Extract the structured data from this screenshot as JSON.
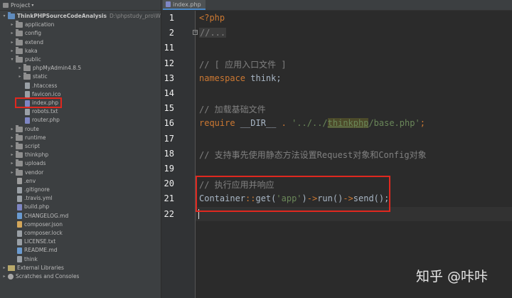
{
  "project_panel": {
    "title": "Project",
    "tree": [
      {
        "label": "ThinkPHPSourceCodeAnalysis",
        "extra": "D:\\phpstudy_pro\\WWW\\Th",
        "type": "root",
        "depth": 0,
        "expanded": true
      },
      {
        "label": "application",
        "type": "folder",
        "depth": 1,
        "expanded": false
      },
      {
        "label": "config",
        "type": "folder",
        "depth": 1,
        "expanded": false
      },
      {
        "label": "extend",
        "type": "folder",
        "depth": 1,
        "expanded": false
      },
      {
        "label": "kaka",
        "type": "folder",
        "depth": 1,
        "expanded": false
      },
      {
        "label": "public",
        "type": "folder",
        "depth": 1,
        "expanded": true
      },
      {
        "label": "phpMyAdmin4.8.5",
        "type": "folder",
        "depth": 2,
        "expanded": false
      },
      {
        "label": "static",
        "type": "folder",
        "depth": 2,
        "expanded": false
      },
      {
        "label": ".htaccess",
        "type": "file-txt",
        "depth": 2
      },
      {
        "label": "favicon.ico",
        "type": "file-txt",
        "depth": 2
      },
      {
        "label": "index.php",
        "type": "file-php",
        "depth": 2,
        "selected": true
      },
      {
        "label": "robots.txt",
        "type": "file-txt",
        "depth": 2
      },
      {
        "label": "router.php",
        "type": "file-php",
        "depth": 2
      },
      {
        "label": "route",
        "type": "folder",
        "depth": 1,
        "expanded": false
      },
      {
        "label": "runtime",
        "type": "folder",
        "depth": 1,
        "expanded": false
      },
      {
        "label": "script",
        "type": "folder",
        "depth": 1,
        "expanded": false
      },
      {
        "label": "thinkphp",
        "type": "folder",
        "depth": 1,
        "expanded": false
      },
      {
        "label": "uploads",
        "type": "folder",
        "depth": 1,
        "expanded": false
      },
      {
        "label": "vendor",
        "type": "folder",
        "depth": 1,
        "expanded": false
      },
      {
        "label": ".env",
        "type": "file-env",
        "depth": 1
      },
      {
        "label": ".gitignore",
        "type": "file-txt",
        "depth": 1
      },
      {
        "label": ".travis.yml",
        "type": "file-txt",
        "depth": 1
      },
      {
        "label": "build.php",
        "type": "file-php",
        "depth": 1
      },
      {
        "label": "CHANGELOG.md",
        "type": "file-md",
        "depth": 1
      },
      {
        "label": "composer.json",
        "type": "file-json",
        "depth": 1
      },
      {
        "label": "composer.lock",
        "type": "file-txt",
        "depth": 1
      },
      {
        "label": "LICENSE.txt",
        "type": "file-txt",
        "depth": 1
      },
      {
        "label": "README.md",
        "type": "file-md",
        "depth": 1
      },
      {
        "label": "think",
        "type": "file-txt",
        "depth": 1
      },
      {
        "label": "External Libraries",
        "type": "lib",
        "depth": 0,
        "expanded": false
      },
      {
        "label": "Scratches and Consoles",
        "type": "scratch",
        "depth": 0,
        "expanded": false
      }
    ]
  },
  "editor": {
    "tab_label": "index.php",
    "lines": [
      {
        "num": "1",
        "tokens": [
          {
            "t": "<?php",
            "c": "tag"
          }
        ]
      },
      {
        "num": "2",
        "fold": "+",
        "tokens": [
          {
            "t": "//...",
            "c": "fold-cm"
          }
        ]
      },
      {
        "num": "11",
        "tokens": []
      },
      {
        "num": "12",
        "tokens": [
          {
            "t": "// [ 应用入口文件 ]",
            "c": "cm"
          }
        ]
      },
      {
        "num": "13",
        "tokens": [
          {
            "t": "namespace",
            "c": "kw"
          },
          {
            "t": " think;",
            "c": ""
          }
        ]
      },
      {
        "num": "14",
        "tokens": []
      },
      {
        "num": "15",
        "tokens": [
          {
            "t": "// 加载基础文件",
            "c": "cm"
          }
        ]
      },
      {
        "num": "16",
        "tokens": [
          {
            "t": "require",
            "c": "kw"
          },
          {
            "t": " __DIR__ ",
            "c": ""
          },
          {
            "t": ".",
            "c": "op"
          },
          {
            "t": " '../../",
            "c": "str"
          },
          {
            "t": "thinkphp",
            "c": "str ul hl"
          },
          {
            "t": "/base.php'",
            "c": "str"
          },
          {
            "t": ";",
            "c": "op"
          }
        ]
      },
      {
        "num": "17",
        "tokens": []
      },
      {
        "num": "18",
        "tokens": [
          {
            "t": "// 支持事先使用静态方法设置Request对象和Config对象",
            "c": "cm"
          }
        ]
      },
      {
        "num": "19",
        "tokens": []
      },
      {
        "num": "20",
        "tokens": [
          {
            "t": "// 执行应用并响应",
            "c": "cm"
          }
        ]
      },
      {
        "num": "21",
        "tokens": [
          {
            "t": "Container",
            "c": ""
          },
          {
            "t": "::",
            "c": "op"
          },
          {
            "t": "get(",
            "c": ""
          },
          {
            "t": "'app'",
            "c": "str"
          },
          {
            "t": ")",
            "c": ""
          },
          {
            "t": "->",
            "c": "op"
          },
          {
            "t": "run()",
            "c": ""
          },
          {
            "t": "->",
            "c": "op"
          },
          {
            "t": "send();",
            "c": ""
          }
        ]
      },
      {
        "num": "22",
        "current": true,
        "tokens": []
      }
    ]
  },
  "watermark": "知乎 @咔咔"
}
